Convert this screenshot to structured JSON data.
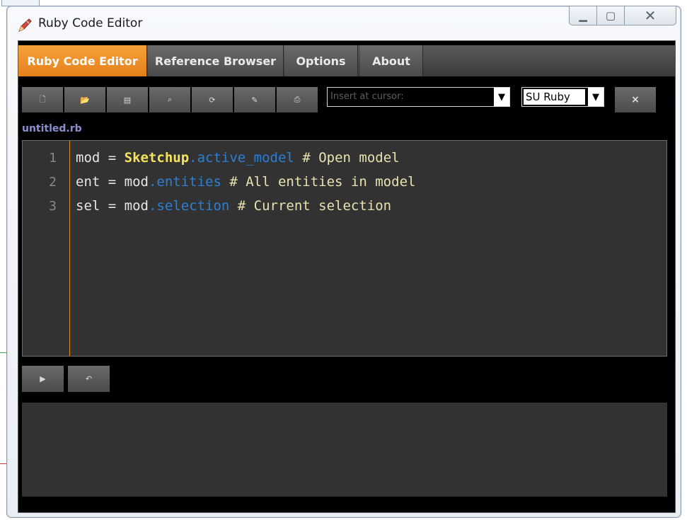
{
  "window": {
    "title": "Ruby Code Editor",
    "controls": {
      "minimize": "▁",
      "maximize": "▢",
      "close": "✕"
    }
  },
  "tabs": [
    {
      "label": "Ruby Code Editor",
      "active": true
    },
    {
      "label": "Reference Browser",
      "active": false
    },
    {
      "label": "Options",
      "active": false
    },
    {
      "label": "About",
      "active": false
    }
  ],
  "toolbar": {
    "buttons": [
      {
        "name": "new-file-icon",
        "glyph": "🗋"
      },
      {
        "name": "open-folder-icon",
        "glyph": "📂"
      },
      {
        "name": "save-icon",
        "glyph": "▤"
      },
      {
        "name": "search-icon",
        "glyph": "⌕"
      },
      {
        "name": "reload-icon",
        "glyph": "⟳"
      },
      {
        "name": "wrench-icon",
        "glyph": "✎"
      },
      {
        "name": "print-icon",
        "glyph": "⎙"
      }
    ],
    "insert_placeholder": "Insert at cursor:",
    "dropdown_arrow": "▼",
    "language": "SU Ruby",
    "clear_label": "×"
  },
  "file": {
    "name": "untitled.rb"
  },
  "editor": {
    "line_numbers": [
      "1",
      "2",
      "3"
    ],
    "lines": [
      {
        "t1": "mod = ",
        "kw": "Sketchup",
        "mth": ".active_model",
        "cmt": " # Open model"
      },
      {
        "t1": "ent = mod",
        "mth": ".entities",
        "cmt": " # All entities in model"
      },
      {
        "t1": "sel = mod",
        "mth": ".selection",
        "cmt": " # Current selection"
      }
    ]
  },
  "runbar": {
    "run_glyph": "▶",
    "undo_glyph": "↶"
  },
  "colors": {
    "accent": "#f39325",
    "keyword": "#f4e35a",
    "method": "#2c7fd6",
    "comment": "#e9e2b0"
  }
}
